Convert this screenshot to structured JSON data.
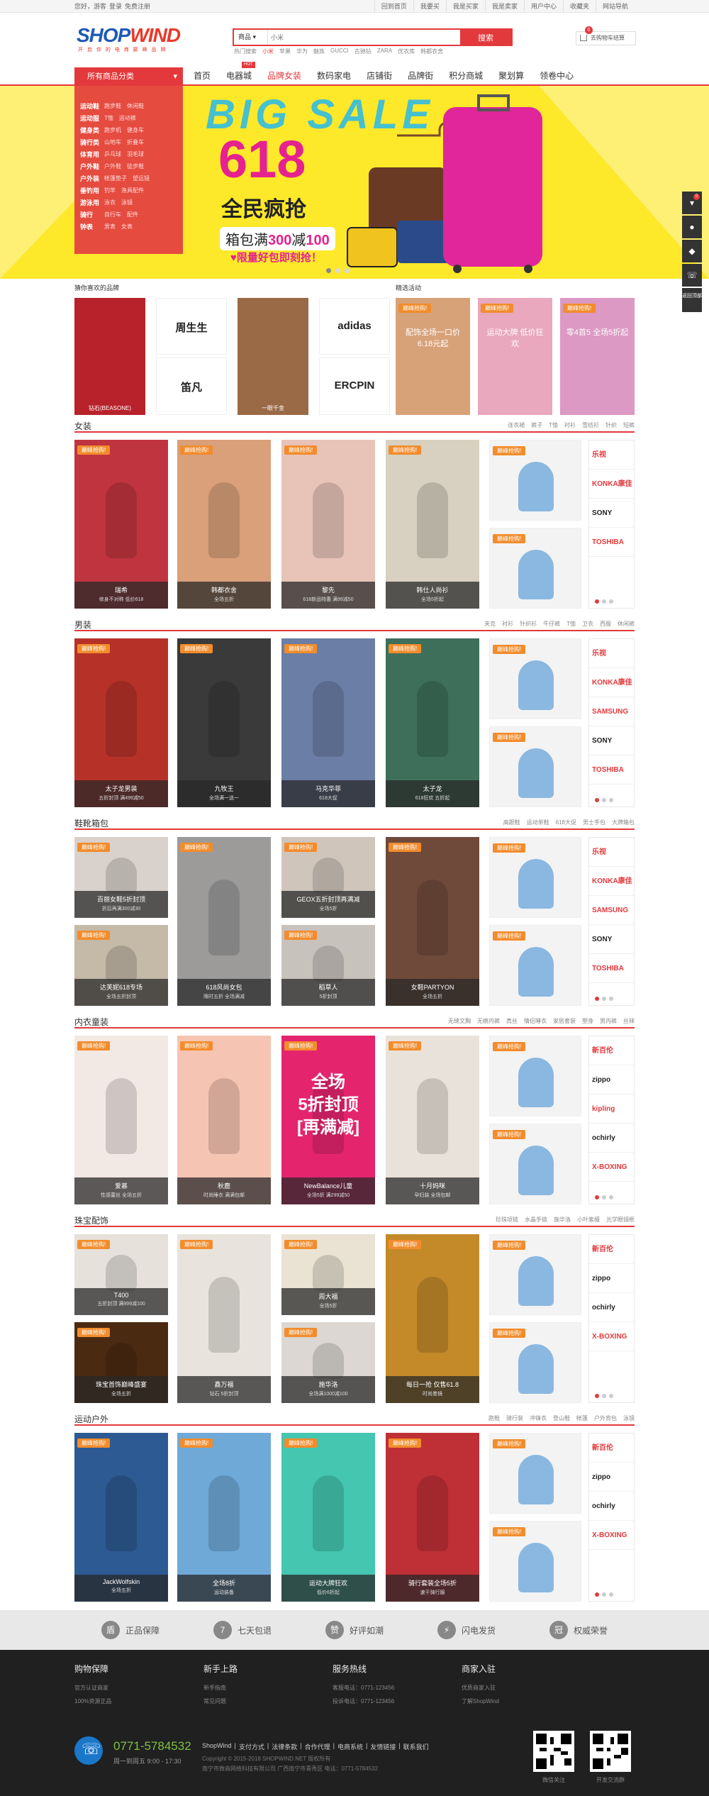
{
  "topbar": {
    "greeting": "您好，游客",
    "login": "登录",
    "register": "免费注册",
    "links": [
      "回到首页",
      "我要买",
      "我是买家",
      "我是卖家",
      "用户中心",
      "收藏夹",
      "网站导航"
    ]
  },
  "header": {
    "logo_a": "SHOP",
    "logo_b": "WIND",
    "slogan": "开 启 你 的 电 商 巅 峰 品 牌",
    "search": {
      "category": "商品",
      "placeholder": "小米",
      "button": "搜索"
    },
    "hot_words": [
      "热门搜索",
      "小米",
      "苹果",
      "华为",
      "魅族",
      "GUCCI",
      "古驰钻",
      "ZARA",
      "优衣库",
      "韩都衣舍"
    ],
    "cart": {
      "label": "去购物车结算",
      "count": "0"
    }
  },
  "nav": {
    "all_categories": "所有商品分类",
    "items": [
      "首页",
      "电器城",
      "品牌女装",
      "数码家电",
      "店铺街",
      "品牌街",
      "积分商城",
      "聚划算",
      "领卷中心"
    ],
    "hot_badge": "HOT"
  },
  "category_menu": [
    {
      "name": "运动鞋",
      "subs": [
        "跑步鞋",
        "休闲鞋"
      ]
    },
    {
      "name": "运动服",
      "subs": [
        "T恤",
        "运动裤"
      ]
    },
    {
      "name": "健身类",
      "subs": [
        "跑步机",
        "健身车"
      ]
    },
    {
      "name": "骑行类",
      "subs": [
        "山地车",
        "折叠车"
      ]
    },
    {
      "name": "体育用",
      "subs": [
        "乒乓球",
        "羽毛球"
      ]
    },
    {
      "name": "户外鞋",
      "subs": [
        "户外鞋",
        "徒步鞋"
      ]
    },
    {
      "name": "户外装",
      "subs": [
        "帐篷垫子",
        "望远镜"
      ]
    },
    {
      "name": "垂钓用",
      "subs": [
        "钓竿",
        "渔具配件"
      ]
    },
    {
      "name": "游泳用",
      "subs": [
        "泳衣",
        "泳镜"
      ]
    },
    {
      "name": "骑行",
      "subs": [
        "自行车",
        "配件"
      ]
    },
    {
      "name": "钟表",
      "subs": [
        "男表",
        "女表"
      ]
    }
  ],
  "banner": {
    "big_sale": "BIG SALE",
    "n618": "618",
    "headline": "全民疯抢",
    "promo_a": "箱包满",
    "promo_b": "300",
    "promo_c": "减",
    "promo_d": "100",
    "limit": "♥限量好包即刻抢！"
  },
  "sidebar": {
    "badge": "0",
    "back": "返回顶部"
  },
  "brands": {
    "title": "猜你喜欢的品牌",
    "tiles": [
      "钻石(BEASONE)",
      "周生生",
      "adidas",
      "笛凡",
      "一眼千金",
      "ERCPIN"
    ],
    "title2": "精选活动",
    "act": [
      "配饰全场一口价 6.18元起",
      "运动大牌 低价狂欢",
      "零4首5 全场5折起"
    ]
  },
  "floors": [
    {
      "title": "女装",
      "keys": [
        "连衣裙",
        "裤子",
        "T恤",
        "衬衫",
        "雪纺衫",
        "针织",
        "短裤"
      ],
      "cards": [
        [
          "瑞希",
          "修身不对称 低价618"
        ],
        [
          "韩都衣舍",
          "全场五折"
        ],
        [
          "黎先",
          "618新品特惠 满99减50"
        ],
        [
          "韩仕人尚衫",
          "全场5折起"
        ]
      ],
      "side": [
        "乐视",
        "KONKA康佳",
        "SONY",
        "TOSHIBA"
      ]
    },
    {
      "title": "男装",
      "keys": [
        "夹克",
        "衬衫",
        "针织衫",
        "牛仔裤",
        "T恤",
        "卫衣",
        "西服",
        "休闲裤"
      ],
      "cards": [
        [
          "太子龙男装",
          "五折封顶 满499减50"
        ],
        [
          "九牧王",
          "全场满一送一"
        ],
        [
          "马克华菲",
          "618大促"
        ],
        [
          "太子龙",
          "618狂欢 五折起"
        ]
      ],
      "side": [
        "乐视",
        "KONKA康佳",
        "SAMSUNG",
        "SONY",
        "TOSHIBA"
      ]
    },
    {
      "title": "鞋靴箱包",
      "keys": [
        "高跟鞋",
        "运动单鞋",
        "618大促",
        "男士手包",
        "大牌箱包"
      ],
      "cards": [
        [
          "百丽女鞋5折封顶",
          "折后再满300减30"
        ],
        [
          "达芙妮618专场",
          "全场五折封顶"
        ],
        [
          "618风尚女包",
          "限时五折 全场满减"
        ],
        [
          "GEOX五折封顶再满减",
          "全场5折"
        ],
        [
          "稻草人",
          "5折封顶"
        ],
        [
          "女鞋PARTYON",
          "全场五折"
        ]
      ],
      "side": [
        "乐视",
        "KONKA康佳",
        "SAMSUNG",
        "SONY",
        "TOSHIBA"
      ]
    },
    {
      "title": "内衣童装",
      "keys": [
        "无缝文胸",
        "无痕内裤",
        "真丝",
        "情侣睡衣",
        "家居套装",
        "塑身",
        "男内裤",
        "丝袜"
      ],
      "cards": [
        [
          "爱慕",
          "性感蕾丝 全场五折"
        ],
        [
          "秋鹿",
          "时尚睡衣 满满包邮"
        ],
        [
          "NewBalance儿童",
          "全场5折 满299减50"
        ],
        [
          "十月妈咪",
          "孕妇装 全场包邮"
        ]
      ],
      "banner": [
        "全场",
        "5折封顶",
        "[再满减]"
      ],
      "side": [
        "新百伦",
        "zippo",
        "kipling",
        "ochirly",
        "X-BOXING"
      ]
    },
    {
      "title": "珠宝配饰",
      "keys": [
        "珍珠项链",
        "水晶手链",
        "施华洛",
        "小叶紫檀",
        "光学眼镜框"
      ],
      "cards": [
        [
          "T400",
          "五折封顶 满999减100"
        ],
        [
          "珠宝首饰巅峰盛宴",
          "全场五折"
        ],
        [
          "鑫万福",
          "钻石 5折封顶"
        ],
        [
          "周大福",
          "全场5折"
        ],
        [
          "施华洛",
          "全场满1000减100"
        ],
        [
          "每日一抢 仅售61.8",
          "时尚墨镜"
        ]
      ],
      "side": [
        "新百伦",
        "zippo",
        "ochirly",
        "X-BOXING"
      ]
    },
    {
      "title": "运动户外",
      "keys": [
        "跑鞋",
        "骑行装",
        "冲锋衣",
        "登山鞋",
        "帐篷",
        "户外背包",
        "泳镜"
      ],
      "cards": [
        [
          "JackWolfskin",
          "全场五折"
        ],
        [
          "全场8折",
          "运动装备"
        ],
        [
          "运动大牌狂欢",
          "低价6折起"
        ],
        [
          "骑行套装全场5折",
          "速干骑行服"
        ]
      ],
      "side": [
        "新百伦",
        "zippo",
        "ochirly",
        "X-BOXING"
      ]
    }
  ],
  "ribbon": "巅峰抢购!",
  "assure": [
    "正品保障",
    "七天包退",
    "好评如潮",
    "闪电发货",
    "权威荣誉"
  ],
  "footer": {
    "cols": [
      {
        "h": "购物保障",
        "l": [
          "官方认证商家",
          "100%资源正品"
        ]
      },
      {
        "h": "新手上路",
        "l": [
          "新手指南",
          "常见问题"
        ]
      },
      {
        "h": "服务热线",
        "l": [
          "客服电话：0771-123456",
          "投诉电话：0771-123456"
        ]
      },
      {
        "h": "商家入驻",
        "l": [
          "优质商家入驻",
          " 了解ShopWind"
        ]
      }
    ],
    "tel": "0771-5784532",
    "hours": "周一到周五 9:00 - 17:30",
    "links": [
      "ShopWind",
      "|",
      "支付方式",
      "|",
      "法律条款",
      "|",
      "合作代理",
      "|",
      "电商系统",
      "|",
      "友情链接",
      "|",
      "联系我们"
    ],
    "copy1": "Copyright © 2015-2018  SHOPWIND.NET  版权所有",
    "copy2": "南宁市微商网络科技有限公司 广西南宁市青秀区 电话：0771-5784532",
    "qr": [
      "微信关注",
      "开发交流群"
    ]
  },
  "colors": {
    "accent": "#e4393c",
    "banner": "#fde82a"
  }
}
